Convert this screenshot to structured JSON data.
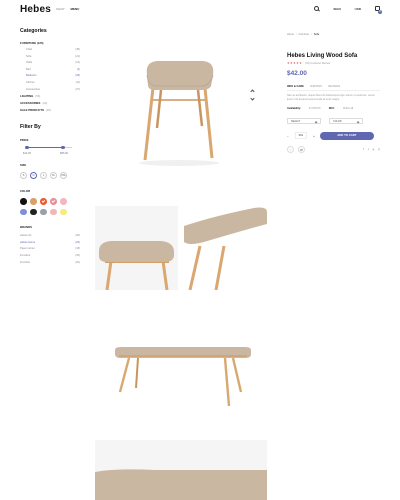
{
  "header": {
    "logo": "Hebes",
    "nav": [
      "SHOP",
      "MENU"
    ],
    "right": {
      "account": "SIGN",
      "currency": "USD",
      "cart_count": "0"
    }
  },
  "sidebar": {
    "categories_title": "Categories",
    "groups": [
      {
        "label": "FURNITURE (125)",
        "items": [
          {
            "label": "Chair",
            "count": "(45)"
          },
          {
            "label": "Sofa",
            "count": "(21)"
          },
          {
            "label": "Table",
            "count": "(12)"
          },
          {
            "label": "Bed",
            "count": "(9)"
          },
          {
            "label": "Bedroom",
            "count": "(18)",
            "active": true
          },
          {
            "label": "Kitchen",
            "count": "(11)"
          },
          {
            "label": "Accessories",
            "count": "(27)"
          }
        ]
      }
    ],
    "sections": [
      {
        "label": "LIGHTING",
        "count": "(56)"
      },
      {
        "label": "ACCESSORIES",
        "count": "(34)"
      },
      {
        "label": "SALE PRODUCTS",
        "count": "(18)"
      }
    ],
    "filter_title": "Filter By",
    "price": {
      "label": "PRICE",
      "min": "$12.00",
      "max": "$95.00",
      "range_low": 0.0,
      "range_high": 0.8
    },
    "size": {
      "label": "SIZE",
      "options": [
        "S",
        "M",
        "L",
        "XL",
        "XXL"
      ],
      "selected": "M"
    },
    "color": {
      "label": "COLOR",
      "swatches": [
        "#111111",
        "#d9a06a",
        "#e85f2f",
        "#e8909a",
        "#f3b7c0",
        "#7f8fd8",
        "#222222",
        "#9aa0a8",
        "#f2b6b6",
        "#f6ec7a"
      ],
      "selected_indices": [
        2,
        3
      ]
    },
    "brands": {
      "label": "BRANDS",
      "items": [
        {
          "label": "Hebes Art",
          "count": "(20)"
        },
        {
          "label": "Hebes Home",
          "count": "(22)",
          "active": true
        },
        {
          "label": "Paper Home",
          "count": "(18)"
        },
        {
          "label": "Furniture",
          "count": "(15)"
        },
        {
          "label": "Frenchie",
          "count": "(10)"
        }
      ]
    }
  },
  "product": {
    "breadcrumb": [
      "Home",
      "Furniture",
      "Sofa"
    ],
    "title": "Hebes Living Wood Sofa",
    "stars": "★★★★★",
    "reviews": "(02) Customer Review",
    "price": "$42.00",
    "tabs": [
      "INFO & CARE",
      "SHIPPING",
      "REVIEWS"
    ],
    "description": "Nam et architecto, neque libero sit doloremque fuga, harum ut quod iste, Lorem ipsum nisi deserunt assumenda sit enim magni.",
    "availability_label": "Availability:",
    "availability": [
      "IN STOCK",
      "SKU:",
      "SOFA-18"
    ],
    "select_size": "SELECT",
    "select_color": "COLOR",
    "qty": "001",
    "add_to_cart": "ADD TO CART"
  }
}
